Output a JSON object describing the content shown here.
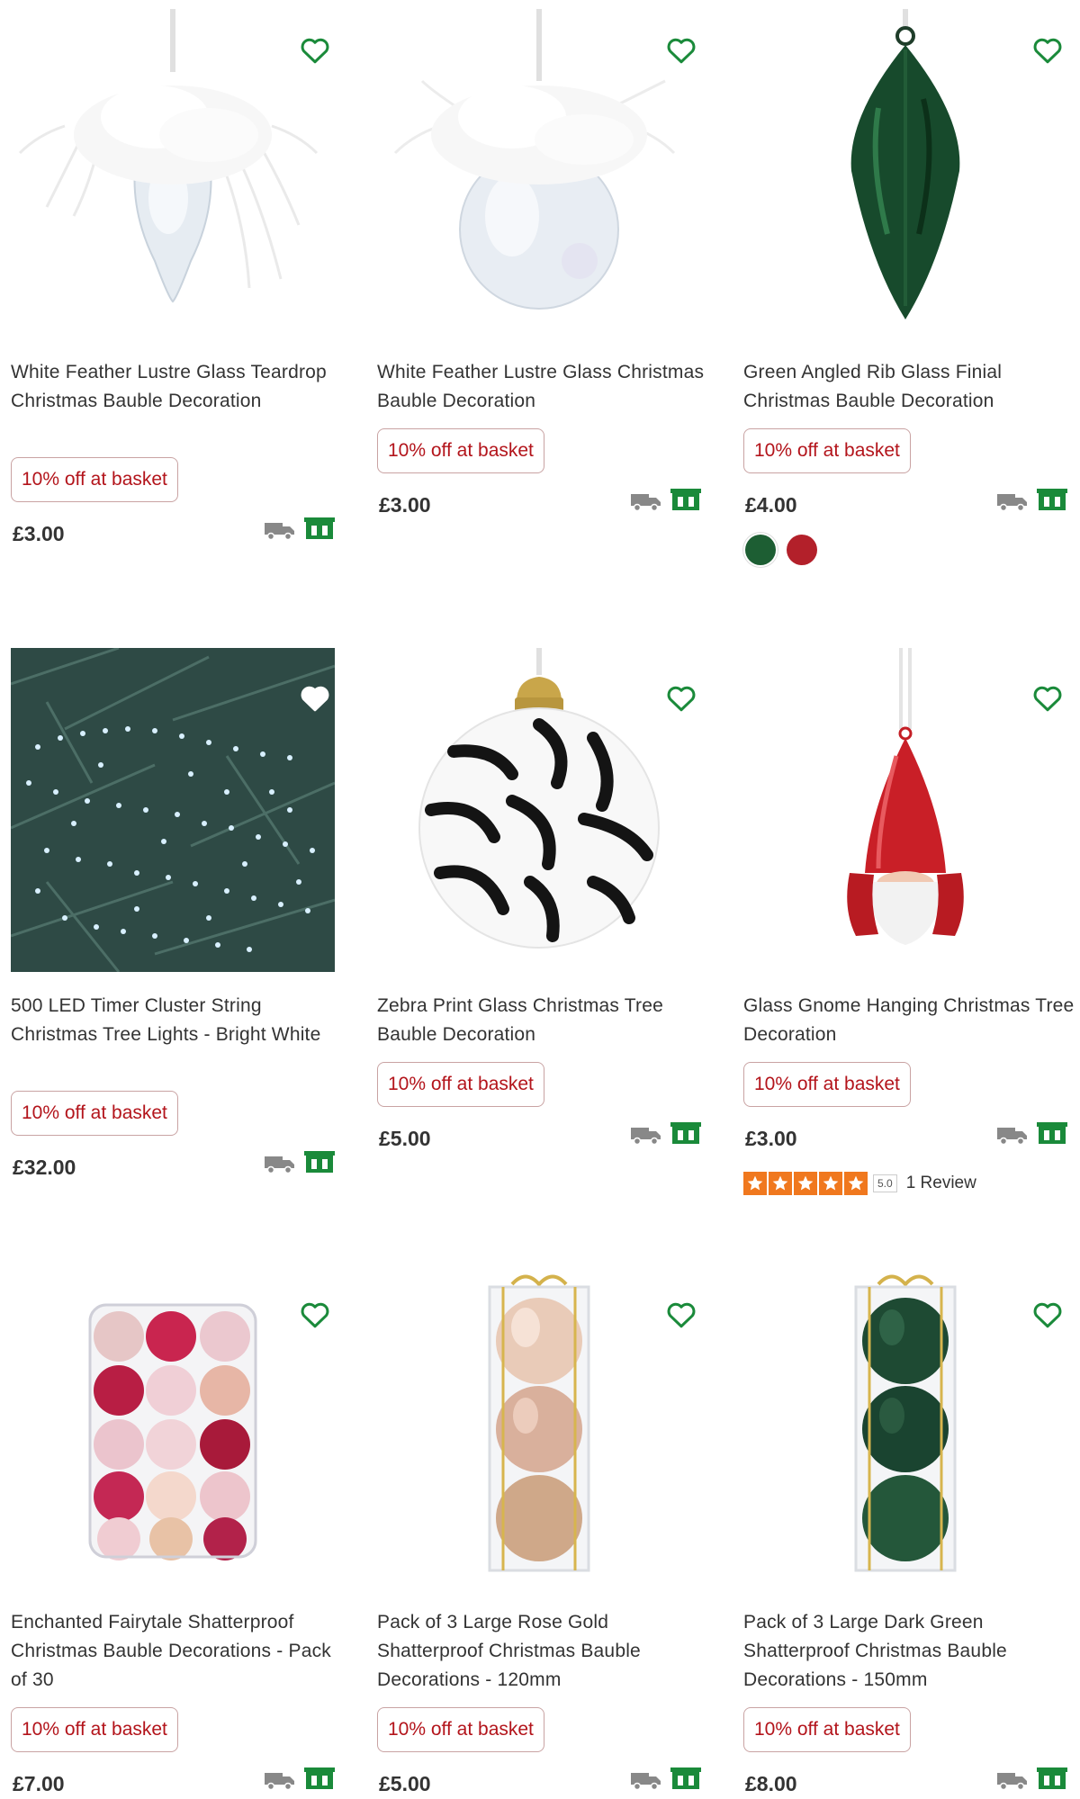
{
  "products": [
    {
      "title": "White Feather Lustre Glass Teardrop Christmas Bauble Decoration",
      "promo": "10% off at basket",
      "price": "£3.00",
      "image": "white-feather-teardrop-bauble"
    },
    {
      "title": "White Feather Lustre Glass Christmas Bauble Decoration",
      "promo": "10% off at basket",
      "price": "£3.00",
      "image": "white-feather-round-bauble"
    },
    {
      "title": "Green Angled Rib Glass Finial Christmas Bauble Decoration",
      "promo": "10% off at basket",
      "price": "£4.00",
      "image": "green-finial-bauble",
      "swatches": [
        "#1d5e33",
        "#b3202a"
      ]
    },
    {
      "title": "500 LED Timer Cluster String Christmas Tree Lights - Bright White",
      "promo": "10% off at basket",
      "price": "£32.00",
      "image": "cluster-lights"
    },
    {
      "title": "Zebra Print Glass Christmas Tree Bauble Decoration",
      "promo": "10% off at basket",
      "price": "£5.00",
      "image": "zebra-bauble"
    },
    {
      "title": "Glass Gnome Hanging Christmas Tree Decoration",
      "promo": "10% off at basket",
      "price": "£3.00",
      "image": "gnome-decoration",
      "rating": {
        "score": "5.0",
        "reviews": "1 Review",
        "stars": 5
      }
    },
    {
      "title": "Enchanted Fairytale Shatterproof Christmas Bauble Decorations - Pack of 30",
      "promo": "10% off at basket",
      "price": "£7.00",
      "image": "pink-bauble-pack"
    },
    {
      "title": "Pack of 3 Large Rose Gold Shatterproof Christmas Bauble Decorations - 120mm",
      "promo": "10% off at basket",
      "price": "£5.00",
      "image": "rose-gold-bauble-pack"
    },
    {
      "title": "Pack of 3 Large Dark Green Shatterproof Christmas Bauble Decorations - 150mm",
      "promo": "10% off at basket",
      "price": "£8.00",
      "image": "dark-green-bauble-pack"
    }
  ],
  "colors": {
    "heart": "#1a8a3a",
    "promo_text": "#b3141b",
    "store_icon": "#1a8a3a",
    "truck_icon": "#888888",
    "star": "#f0781e"
  },
  "icons": {
    "wishlist": "heart-icon",
    "delivery": "truck-icon",
    "click_collect": "store-icon"
  }
}
